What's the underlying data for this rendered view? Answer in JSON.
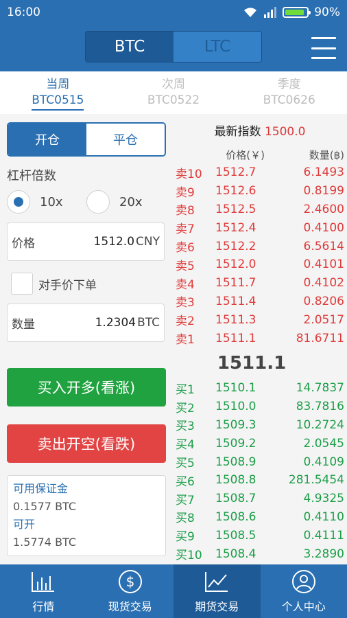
{
  "status_bar": {
    "time": "16:00",
    "battery": "90%",
    "battery_level": 0.9
  },
  "header": {
    "coins": [
      "BTC",
      "LTC"
    ],
    "selected_coin": "BTC"
  },
  "contract_tabs": [
    {
      "period": "当周",
      "code": "BTC0515"
    },
    {
      "period": "次周",
      "code": "BTC0522"
    },
    {
      "period": "季度",
      "code": "BTC0626"
    }
  ],
  "trade_form": {
    "open_label": "开仓",
    "close_label": "平仓",
    "leverage_title": "杠杆倍数",
    "leverage_options": [
      "10x",
      "20x"
    ],
    "selected_leverage": "10x",
    "price": {
      "label": "价格",
      "value": "1512.0",
      "unit": "CNY"
    },
    "counterparty_label": "对手价下单",
    "quantity": {
      "label": "数量",
      "value": "1.2304",
      "unit": "BTC"
    },
    "buy_button": "买入开多(看涨)",
    "sell_button": "卖出开空(看跌)",
    "available_margin_label": "可用保证金",
    "available_margin_value": "0.1577 BTC",
    "can_open_label": "可开",
    "can_open_value": "1.5774 BTC"
  },
  "order_book": {
    "index_label": "最新指数",
    "index_value": "1500.0",
    "price_header": "价格(￥)",
    "qty_header": "数量(฿)",
    "asks": [
      {
        "label": "卖10",
        "price": "1512.7",
        "qty": "6.1493"
      },
      {
        "label": "卖9",
        "price": "1512.6",
        "qty": "0.8199"
      },
      {
        "label": "卖8",
        "price": "1512.5",
        "qty": "2.4600"
      },
      {
        "label": "卖7",
        "price": "1512.4",
        "qty": "0.4100"
      },
      {
        "label": "卖6",
        "price": "1512.2",
        "qty": "6.5614"
      },
      {
        "label": "卖5",
        "price": "1512.0",
        "qty": "0.4101"
      },
      {
        "label": "卖4",
        "price": "1511.7",
        "qty": "0.4102"
      },
      {
        "label": "卖3",
        "price": "1511.4",
        "qty": "0.8206"
      },
      {
        "label": "卖2",
        "price": "1511.3",
        "qty": "2.0517"
      },
      {
        "label": "卖1",
        "price": "1511.1",
        "qty": "81.6711"
      }
    ],
    "last_price": "1511.1",
    "bids": [
      {
        "label": "买1",
        "price": "1510.1",
        "qty": "14.7837"
      },
      {
        "label": "买2",
        "price": "1510.0",
        "qty": "83.7816"
      },
      {
        "label": "买3",
        "price": "1509.3",
        "qty": "10.2724"
      },
      {
        "label": "买4",
        "price": "1509.2",
        "qty": "2.0545"
      },
      {
        "label": "买5",
        "price": "1508.9",
        "qty": "0.4109"
      },
      {
        "label": "买6",
        "price": "1508.8",
        "qty": "281.5454"
      },
      {
        "label": "买7",
        "price": "1508.7",
        "qty": "4.9325"
      },
      {
        "label": "买8",
        "price": "1508.6",
        "qty": "0.4110"
      },
      {
        "label": "买9",
        "price": "1508.5",
        "qty": "0.4111"
      },
      {
        "label": "买10",
        "price": "1508.4",
        "qty": "3.2890"
      }
    ],
    "colors": {
      "ask": "#e03a3a",
      "bid": "#1c9e48"
    }
  },
  "bottom_nav": [
    {
      "label": "行情",
      "icon": "bar-chart-icon"
    },
    {
      "label": "现货交易",
      "icon": "dollar-circle-icon"
    },
    {
      "label": "期货交易",
      "icon": "line-chart-icon",
      "active": true
    },
    {
      "label": "个人中心",
      "icon": "user-icon"
    }
  ],
  "colors": {
    "primary": "#2a6fb2",
    "primary_dark": "#1d5a96",
    "buy": "#1fa23f",
    "sell": "#e24444"
  }
}
